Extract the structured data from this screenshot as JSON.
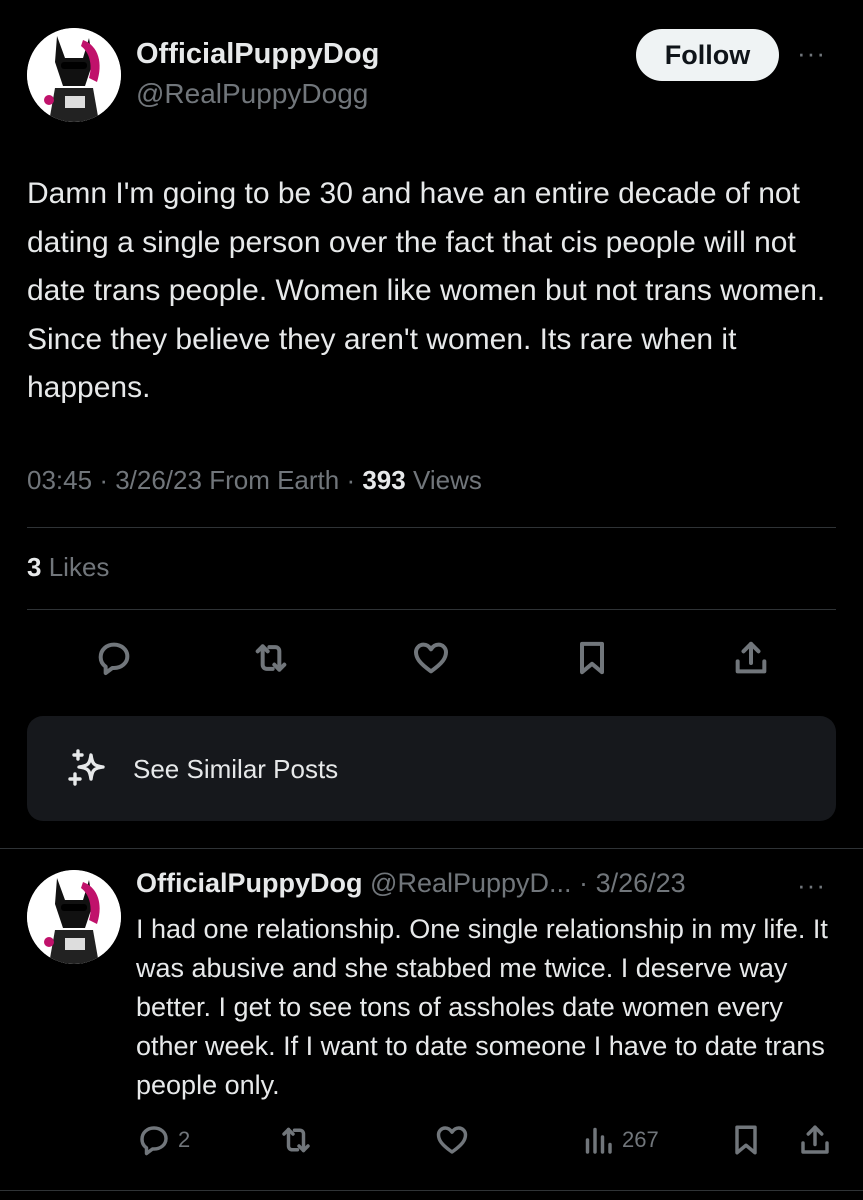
{
  "main_post": {
    "display_name": "OfficialPuppyDog",
    "handle": "@RealPuppyDogg",
    "follow_label": "Follow",
    "more_label": "···",
    "text": "Damn I'm going to be 30 and have an entire decade of not dating a single person over the fact that cis people will not date trans people. Women like women but not trans women. Since they believe they aren't women. Its rare when it happens.",
    "time": "03:45",
    "date": "3/26/23",
    "source": "From Earth",
    "views_count": "393",
    "views_label": "Views",
    "likes_count": "3",
    "likes_label": "Likes",
    "action_icons": [
      "reply-icon",
      "repost-icon",
      "like-icon",
      "bookmark-icon",
      "share-icon"
    ]
  },
  "similar_posts": {
    "icon": "sparkle-icon",
    "label": "See Similar Posts"
  },
  "reply": {
    "display_name": "OfficialPuppyDog",
    "handle": "@RealPuppyD...",
    "separator": "·",
    "date": "3/26/23",
    "more_label": "···",
    "text": "I had one relationship. One single relationship in my life. It was abusive and she stabbed me twice. I deserve way better. I get to see tons of assholes date women every other week. If I want to date someone I have to date trans people only.",
    "reply_count": "2",
    "views_count": "267"
  },
  "colors": {
    "background": "#000000",
    "text": "#e7e9ea",
    "muted": "#71767b",
    "divider": "#2f3336",
    "card": "#16181c",
    "avatar_accent": "#c0126b"
  }
}
